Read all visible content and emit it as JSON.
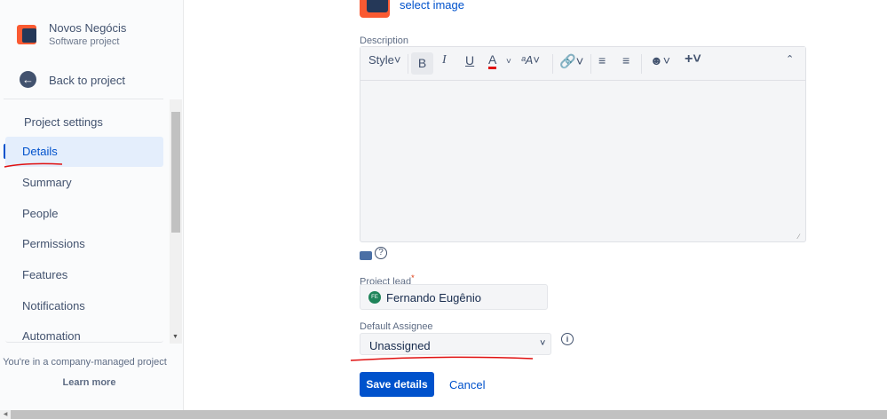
{
  "sidebar": {
    "project_name": "Novos Negócis",
    "project_type": "Software project",
    "back": "Back to project",
    "section": "Project settings",
    "items": [
      {
        "label": "Details"
      },
      {
        "label": "Summary"
      },
      {
        "label": "People"
      },
      {
        "label": "Permissions"
      },
      {
        "label": "Features"
      },
      {
        "label": "Notifications"
      },
      {
        "label": "Automation"
      }
    ],
    "footer_text": "You're in a company-managed project",
    "learn_more": "Learn more"
  },
  "main": {
    "select_image": "select image",
    "description_label": "Description",
    "toolbar": {
      "style": "Style",
      "bold": "B",
      "italic": "I",
      "underline": "U",
      "color": "A"
    },
    "project_lead_label": "Project lead",
    "required": "*",
    "project_lead_initials": "FE",
    "project_lead": "Fernando Eugênio",
    "assignee_label": "Default Assignee",
    "assignee_value": "Unassigned",
    "save": "Save details",
    "cancel": "Cancel"
  },
  "colors": {
    "accent": "#0052cc",
    "annotation": "#e01010"
  }
}
